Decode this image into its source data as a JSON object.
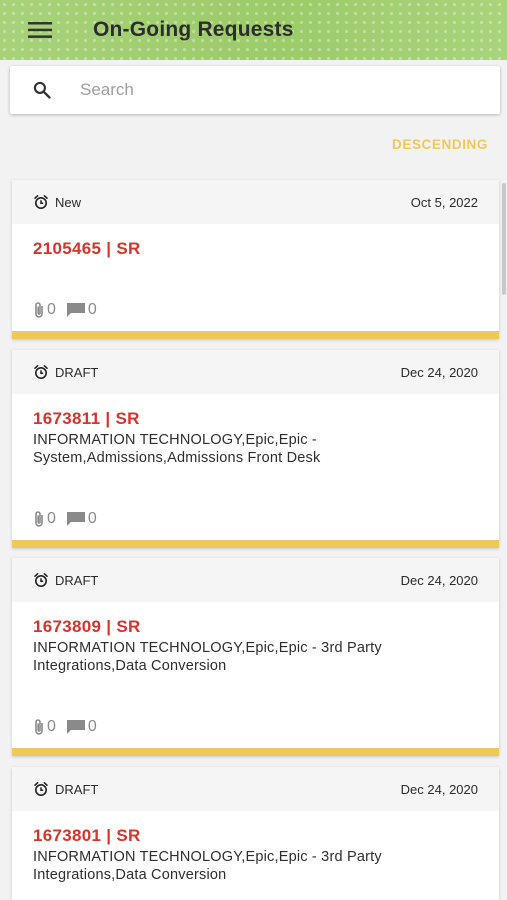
{
  "app_bar": {
    "title": "On-Going Requests"
  },
  "search": {
    "placeholder": "Search"
  },
  "sort": {
    "label": "DESCENDING"
  },
  "colors": {
    "accent": "#f0c75a",
    "request_id": "#d8342c",
    "app_bar": "#9fcf6f"
  },
  "requests": [
    {
      "status": "New",
      "date": "Oct 5, 2022",
      "title": "2105465 | SR",
      "description": "",
      "attachments": "0",
      "comments": "0"
    },
    {
      "status": "DRAFT",
      "date": "Dec 24, 2020",
      "title": "1673811 | SR",
      "description": "INFORMATION TECHNOLOGY,Epic,Epic - System,Admissions,Admissions Front Desk",
      "attachments": "0",
      "comments": "0"
    },
    {
      "status": "DRAFT",
      "date": "Dec 24, 2020",
      "title": "1673809 | SR",
      "description": "INFORMATION TECHNOLOGY,Epic,Epic - 3rd Party Integrations,Data Conversion",
      "attachments": "0",
      "comments": "0"
    },
    {
      "status": "DRAFT",
      "date": "Dec 24, 2020",
      "title": "1673801 | SR",
      "description": "INFORMATION TECHNOLOGY,Epic,Epic - 3rd Party Integrations,Data Conversion",
      "attachments": "0",
      "comments": "0"
    }
  ],
  "icons": {
    "menu": "menu-icon",
    "search": "search-icon",
    "status": "alarm-clock-icon",
    "attachment": "paperclip-icon",
    "comment": "comment-icon"
  }
}
